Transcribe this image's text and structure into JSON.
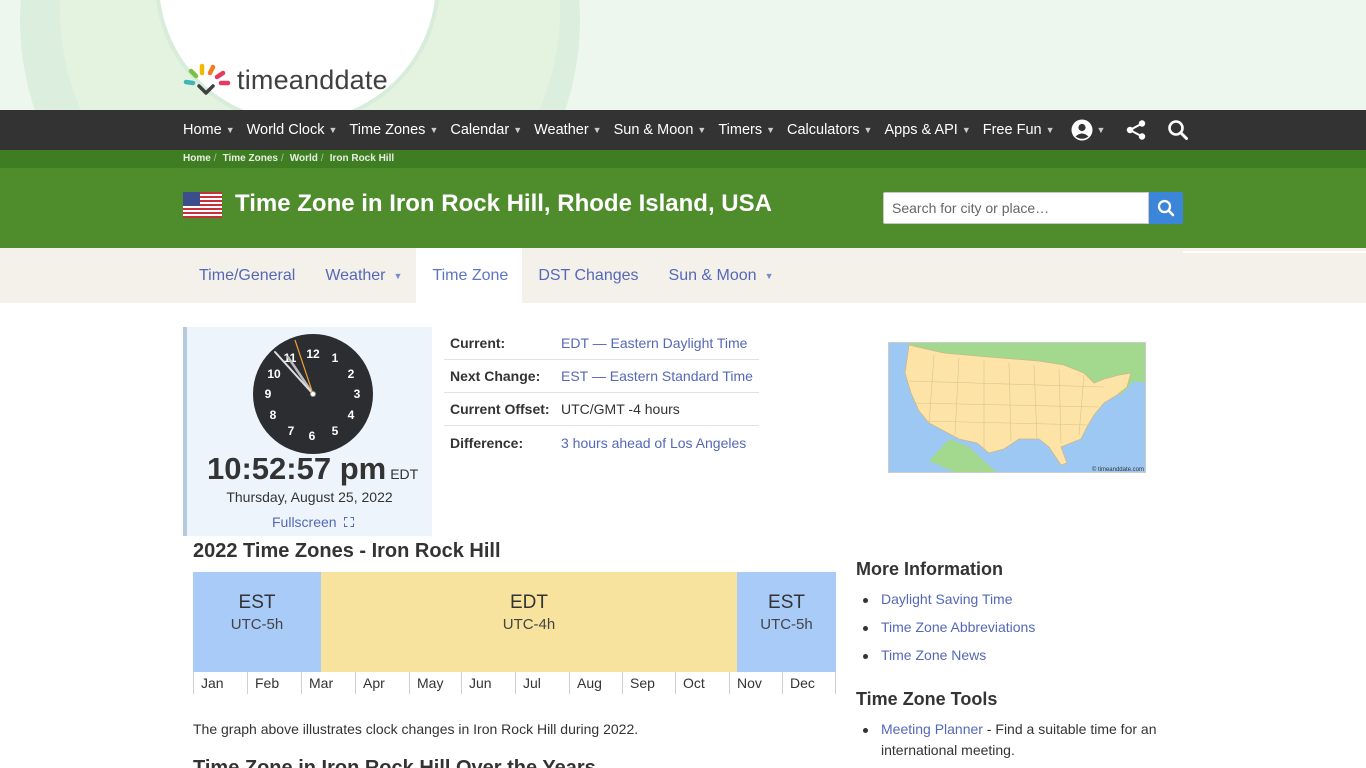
{
  "brand": {
    "logo_text": "timeanddate"
  },
  "nav": {
    "items": [
      {
        "label": "Home"
      },
      {
        "label": "World Clock"
      },
      {
        "label": "Time Zones"
      },
      {
        "label": "Calendar"
      },
      {
        "label": "Weather"
      },
      {
        "label": "Sun & Moon"
      },
      {
        "label": "Timers"
      },
      {
        "label": "Calculators"
      },
      {
        "label": "Apps & API"
      },
      {
        "label": "Free Fun"
      }
    ],
    "icons": [
      "account-icon",
      "share-icon",
      "search-icon"
    ]
  },
  "breadcrumb": [
    "Home",
    "Time Zones",
    "World",
    "Iron Rock Hill"
  ],
  "title": "Time Zone in Iron Rock Hill, Rhode Island, USA",
  "search": {
    "placeholder": "Search for city or place…"
  },
  "tabs": [
    {
      "label": "Time/General",
      "dropdown": false,
      "active": false
    },
    {
      "label": "Weather",
      "dropdown": true,
      "active": false
    },
    {
      "label": "Time Zone",
      "dropdown": false,
      "active": true
    },
    {
      "label": "DST Changes",
      "dropdown": false,
      "active": false
    },
    {
      "label": "Sun & Moon",
      "dropdown": true,
      "active": false
    }
  ],
  "clock": {
    "numerals": [
      "12",
      "1",
      "2",
      "3",
      "4",
      "5",
      "6",
      "7",
      "8",
      "9",
      "10",
      "11"
    ],
    "time": "10:52:57 pm",
    "tz": "EDT",
    "date": "Thursday, August 25, 2022",
    "fullscreen_label": "Fullscreen"
  },
  "info": [
    {
      "key": "Current:",
      "value": "EDT — Eastern Daylight Time",
      "link": true
    },
    {
      "key": "Next Change:",
      "value": "EST — Eastern Standard Time",
      "link": true
    },
    {
      "key": "Current Offset:",
      "value": "UTC/GMT -4 hours",
      "link": false
    },
    {
      "key": "Difference:",
      "value": "3 hours ahead of Los Angeles",
      "link": true
    }
  ],
  "map": {
    "credit": "© timeanddate.com"
  },
  "tz_chart": {
    "heading": "2022 Time Zones - Iron Rock Hill",
    "segments": [
      {
        "name": "EST",
        "offset": "UTC-5h",
        "color": "#a9cbf8"
      },
      {
        "name": "EDT",
        "offset": "UTC-4h",
        "color": "#f8e39e"
      },
      {
        "name": "EST",
        "offset": "UTC-5h",
        "color": "#a9cbf8"
      }
    ],
    "months": [
      "Jan",
      "Feb",
      "Mar",
      "Apr",
      "May",
      "Jun",
      "Jul",
      "Aug",
      "Sep",
      "Oct",
      "Nov",
      "Dec"
    ],
    "note": "The graph above illustrates clock changes in Iron Rock Hill during 2022.",
    "next_heading": "Time Zone in Iron Rock Hill Over the Years"
  },
  "sidebar": {
    "more_heading": "More Information",
    "more_links": [
      "Daylight Saving Time",
      "Time Zone Abbreviations",
      "Time Zone News"
    ],
    "tools_heading": "Time Zone Tools",
    "tools": [
      {
        "link": "Meeting Planner",
        "desc": " - Find a suitable time for an international meeting."
      }
    ]
  },
  "colors": {
    "nav_bg": "#333333",
    "title_bg": "#4e8c2c",
    "crumb_bg": "#3f7d23",
    "link": "#5468b8",
    "est": "#a9cbf8",
    "edt": "#f8e39e"
  }
}
